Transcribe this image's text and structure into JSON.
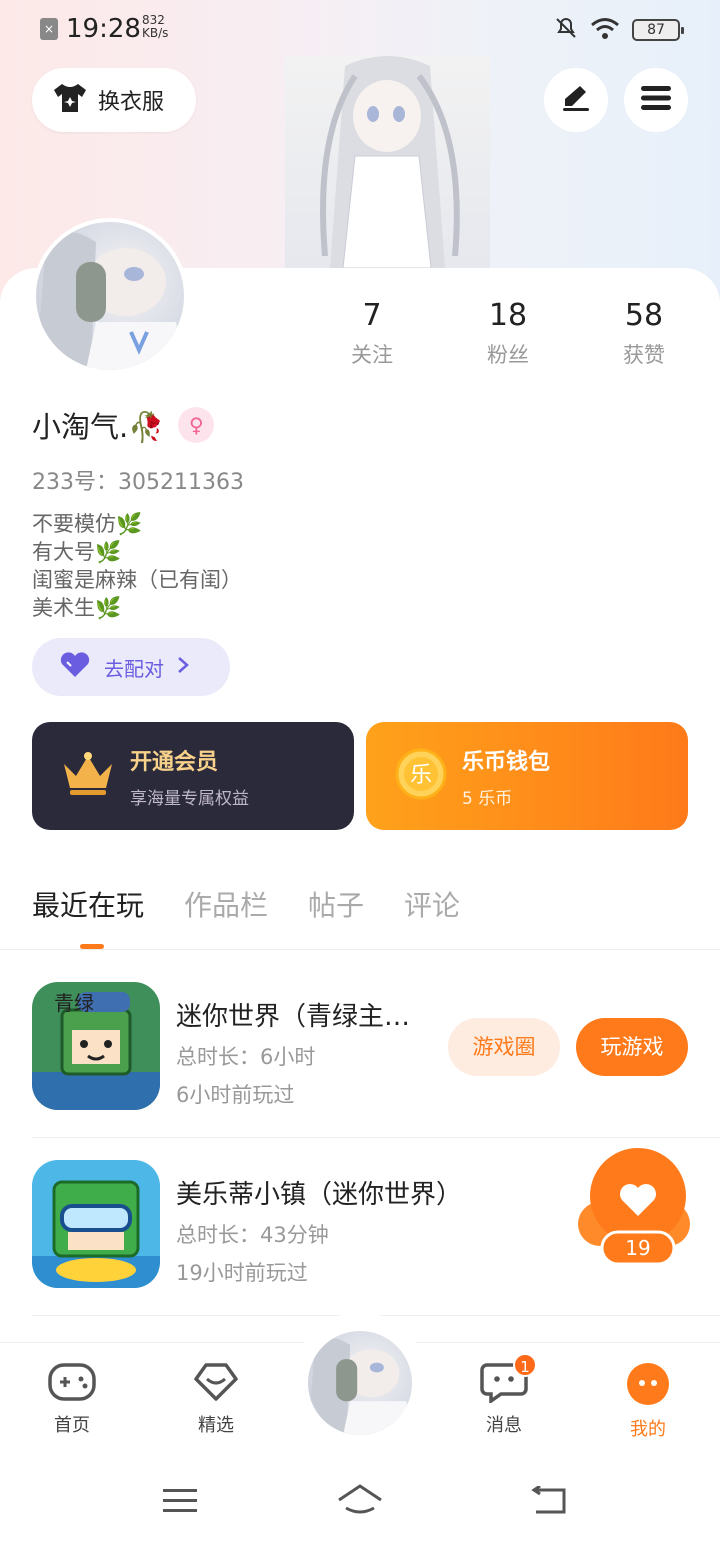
{
  "status_bar": {
    "time": "19:28",
    "speed": "832 KB/s",
    "battery": "87"
  },
  "header": {
    "change_outfit": "换衣服"
  },
  "stats": [
    {
      "value": "7",
      "label": "关注"
    },
    {
      "value": "18",
      "label": "粉丝"
    },
    {
      "value": "58",
      "label": "获赞"
    }
  ],
  "profile": {
    "name": "小淘气.🥀",
    "id_line": "233号：305211363",
    "bio": [
      "不要模仿🌿",
      "有大号🌿",
      "闺蜜是麻辣（已有闺）",
      "美术生🌿"
    ],
    "match_label": "去配对"
  },
  "cards": {
    "vip": {
      "title": "开通会员",
      "subtitle": "享海量专属权益"
    },
    "wallet": {
      "title": "乐币钱包",
      "subtitle": "5 乐币",
      "coin_glyph": "乐"
    }
  },
  "tabs": [
    {
      "label": "最近在玩",
      "active": true
    },
    {
      "label": "作品栏",
      "active": false
    },
    {
      "label": "帖子",
      "active": false
    },
    {
      "label": "评论",
      "active": false
    }
  ],
  "games": [
    {
      "title": "迷你世界（青绿主…",
      "duration": "总时长：6小时",
      "last_played": "6小时前玩过",
      "circle_btn": "游戏圈",
      "play_btn": "玩游戏",
      "icon_text": "青绿"
    },
    {
      "title": "美乐蒂小镇（迷你世界）",
      "duration": "总时长：43分钟",
      "last_played": "19小时前玩过"
    }
  ],
  "like_fab": {
    "count": "19"
  },
  "bottom_nav": [
    {
      "label": "首页",
      "icon": "gamepad-icon"
    },
    {
      "label": "精选",
      "icon": "heart-diamond-icon"
    },
    {
      "label": "",
      "icon": "avatar"
    },
    {
      "label": "消息",
      "icon": "chat-icon",
      "badge": "1"
    },
    {
      "label": "我的",
      "icon": "face-icon",
      "active": true
    }
  ],
  "colors": {
    "accent": "#ff7a1a",
    "match_purple": "#6a5de0",
    "vip_dark": "#2b2a3a",
    "vip_gold": "#f8d18a"
  }
}
